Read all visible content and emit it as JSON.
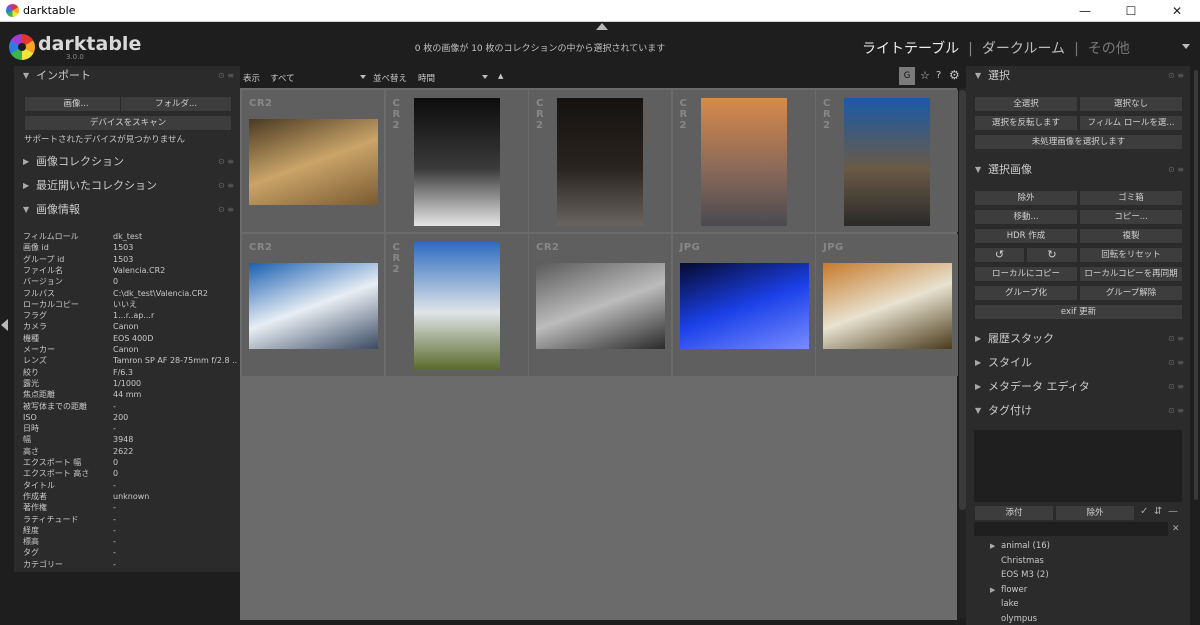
{
  "window": {
    "title": "darktable",
    "controls": {
      "minimize": "—",
      "maximize": "☐",
      "close": "✕"
    }
  },
  "header": {
    "brand": "darktable",
    "version": "3.0.0",
    "status": "0 枚の画像が 10 枚のコレクションの中から選択されています",
    "views": {
      "lighttable": "ライトテーブル",
      "sep": "|",
      "darkroom": "ダークルーム",
      "other": "その他"
    }
  },
  "left": {
    "import": {
      "title": "インポート",
      "image_btn": "画像...",
      "folder_btn": "フォルダ...",
      "scan_btn": "デバイスをスキャン",
      "no_devices": "サポートされたデバイスが見つかりません"
    },
    "collections": "画像コレクション",
    "recent": "最近開いたコレクション",
    "image_info": {
      "title": "画像情報",
      "rows": [
        {
          "k": "フィルムロール",
          "v": "dk_test"
        },
        {
          "k": "画像 id",
          "v": "1503"
        },
        {
          "k": "グループ id",
          "v": "1503"
        },
        {
          "k": "ファイル名",
          "v": "Valencia.CR2"
        },
        {
          "k": "バージョン",
          "v": "0"
        },
        {
          "k": "フルパス",
          "v": "C:\\dk_test\\Valencia.CR2"
        },
        {
          "k": "ローカルコピー",
          "v": "いいえ"
        },
        {
          "k": "フラグ",
          "v": "1...r..ap...r"
        },
        {
          "k": "カメラ",
          "v": "Canon"
        },
        {
          "k": "機種",
          "v": "EOS 400D"
        },
        {
          "k": "メーカー",
          "v": "Canon"
        },
        {
          "k": "レンズ",
          "v": "Tamron SP AF 28-75mm f/2.8 ..."
        },
        {
          "k": "絞り",
          "v": "F/6.3"
        },
        {
          "k": "露光",
          "v": "1/1000"
        },
        {
          "k": "焦点距離",
          "v": "44 mm"
        },
        {
          "k": "被写体までの距離",
          "v": "-"
        },
        {
          "k": "ISO",
          "v": "200"
        },
        {
          "k": "日時",
          "v": "-"
        },
        {
          "k": "幅",
          "v": "3948"
        },
        {
          "k": "高さ",
          "v": "2622"
        },
        {
          "k": "エクスポート 幅",
          "v": "0"
        },
        {
          "k": "エクスポート 高さ",
          "v": "0"
        },
        {
          "k": "タイトル",
          "v": "-"
        },
        {
          "k": "作成者",
          "v": "unknown"
        },
        {
          "k": "著作権",
          "v": "-"
        },
        {
          "k": "ラティチュード",
          "v": "-"
        },
        {
          "k": "経度",
          "v": "-"
        },
        {
          "k": "標高",
          "v": "-"
        },
        {
          "k": "タグ",
          "v": "-"
        },
        {
          "k": "カテゴリー",
          "v": "-"
        }
      ]
    }
  },
  "toolbar": {
    "show_label": "表示",
    "show_value": "すべて",
    "sort_label": "並べ替え",
    "sort_value": "時間",
    "sort_dir": "▲",
    "group_btn": "G",
    "star_icon": "☆",
    "help_icon": "?",
    "gear_icon": "⚙"
  },
  "thumbnails": [
    {
      "label": "CR2",
      "vertical": false,
      "colors": [
        "#4a3a22",
        "#caa468",
        "#7a5a32"
      ]
    },
    {
      "label": "CR2",
      "vertical": true,
      "colors": [
        "#0c0c0c",
        "#3a3a3a",
        "#e6e6e6"
      ]
    },
    {
      "label": "CR2",
      "vertical": true,
      "colors": [
        "#151210",
        "#2a2420",
        "#6a6460"
      ]
    },
    {
      "label": "CR2",
      "vertical": true,
      "colors": [
        "#d88a4a",
        "#8a6a5a",
        "#4a4a50"
      ]
    },
    {
      "label": "CR2",
      "vertical": true,
      "colors": [
        "#1a5aa8",
        "#6a5a48",
        "#2a2a28"
      ]
    },
    {
      "label": "CR2",
      "vertical": false,
      "colors": [
        "#1b5fb2",
        "#e8eef4",
        "#3a4a62"
      ]
    },
    {
      "label": "CR2",
      "vertical": true,
      "colors": [
        "#2e6cc0",
        "#e0e4e8",
        "#5a6a2a"
      ]
    },
    {
      "label": "CR2",
      "vertical": false,
      "colors": [
        "#5a5a5a",
        "#bcbcbc",
        "#2a2a2a"
      ]
    },
    {
      "label": "JPG",
      "vertical": false,
      "colors": [
        "#060a30",
        "#1a40e8",
        "#7a8cff"
      ]
    },
    {
      "label": "JPG",
      "vertical": false,
      "colors": [
        "#c67a2a",
        "#e8e2d0",
        "#4a3a1a"
      ]
    }
  ],
  "right": {
    "select": {
      "title": "選択",
      "all": "全選択",
      "none": "選択なし",
      "invert": "選択を反転します",
      "film_roll": "フィルム ロールを選...",
      "untouched": "未処理画像を選択します"
    },
    "selected": {
      "title": "選択画像",
      "remove": "除外",
      "trash": "ゴミ箱",
      "move": "移動...",
      "copy": "コピー...",
      "hdr": "HDR 作成",
      "duplicate": "複製",
      "rotate_ccw": "↺",
      "rotate_cw": "↻",
      "reset_rot": "回転をリセット",
      "local_copy": "ローカルにコピー",
      "resync": "ローカルコピーを再同期",
      "group": "グループ化",
      "ungroup": "グループ解除",
      "exif": "exif 更新"
    },
    "history": "履歴スタック",
    "styles": "スタイル",
    "metadata": "メタデータ エディタ",
    "tagging": {
      "title": "タグ付け",
      "attach": "添付",
      "detach": "除外",
      "check_icon": "✓",
      "sort_icon": "⇵",
      "minus_icon": "—",
      "clear_icon": "✕",
      "items": [
        {
          "label": "animal (16)",
          "expand": true
        },
        {
          "label": "Christmas",
          "expand": false
        },
        {
          "label": "EOS M3 (2)",
          "expand": false
        },
        {
          "label": "flower",
          "expand": true
        },
        {
          "label": "lake",
          "expand": false
        },
        {
          "label": "olympus",
          "expand": false
        }
      ]
    }
  }
}
